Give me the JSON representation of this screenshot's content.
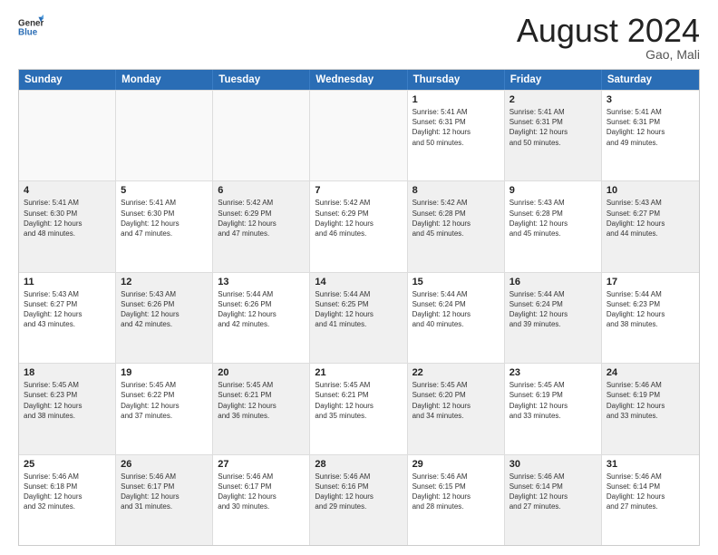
{
  "logo": {
    "general": "General",
    "blue": "Blue"
  },
  "title": {
    "month_year": "August 2024",
    "location": "Gao, Mali"
  },
  "weekdays": [
    "Sunday",
    "Monday",
    "Tuesday",
    "Wednesday",
    "Thursday",
    "Friday",
    "Saturday"
  ],
  "rows": [
    [
      {
        "day": "",
        "info": "",
        "empty": true
      },
      {
        "day": "",
        "info": "",
        "empty": true
      },
      {
        "day": "",
        "info": "",
        "empty": true
      },
      {
        "day": "",
        "info": "",
        "empty": true
      },
      {
        "day": "1",
        "info": "Sunrise: 5:41 AM\nSunset: 6:31 PM\nDaylight: 12 hours\nand 50 minutes.",
        "empty": false
      },
      {
        "day": "2",
        "info": "Sunrise: 5:41 AM\nSunset: 6:31 PM\nDaylight: 12 hours\nand 50 minutes.",
        "empty": false,
        "shaded": true
      },
      {
        "day": "3",
        "info": "Sunrise: 5:41 AM\nSunset: 6:31 PM\nDaylight: 12 hours\nand 49 minutes.",
        "empty": false
      }
    ],
    [
      {
        "day": "4",
        "info": "Sunrise: 5:41 AM\nSunset: 6:30 PM\nDaylight: 12 hours\nand 48 minutes.",
        "empty": false,
        "shaded": true
      },
      {
        "day": "5",
        "info": "Sunrise: 5:41 AM\nSunset: 6:30 PM\nDaylight: 12 hours\nand 47 minutes.",
        "empty": false
      },
      {
        "day": "6",
        "info": "Sunrise: 5:42 AM\nSunset: 6:29 PM\nDaylight: 12 hours\nand 47 minutes.",
        "empty": false,
        "shaded": true
      },
      {
        "day": "7",
        "info": "Sunrise: 5:42 AM\nSunset: 6:29 PM\nDaylight: 12 hours\nand 46 minutes.",
        "empty": false
      },
      {
        "day": "8",
        "info": "Sunrise: 5:42 AM\nSunset: 6:28 PM\nDaylight: 12 hours\nand 45 minutes.",
        "empty": false,
        "shaded": true
      },
      {
        "day": "9",
        "info": "Sunrise: 5:43 AM\nSunset: 6:28 PM\nDaylight: 12 hours\nand 45 minutes.",
        "empty": false
      },
      {
        "day": "10",
        "info": "Sunrise: 5:43 AM\nSunset: 6:27 PM\nDaylight: 12 hours\nand 44 minutes.",
        "empty": false,
        "shaded": true
      }
    ],
    [
      {
        "day": "11",
        "info": "Sunrise: 5:43 AM\nSunset: 6:27 PM\nDaylight: 12 hours\nand 43 minutes.",
        "empty": false
      },
      {
        "day": "12",
        "info": "Sunrise: 5:43 AM\nSunset: 6:26 PM\nDaylight: 12 hours\nand 42 minutes.",
        "empty": false,
        "shaded": true
      },
      {
        "day": "13",
        "info": "Sunrise: 5:44 AM\nSunset: 6:26 PM\nDaylight: 12 hours\nand 42 minutes.",
        "empty": false
      },
      {
        "day": "14",
        "info": "Sunrise: 5:44 AM\nSunset: 6:25 PM\nDaylight: 12 hours\nand 41 minutes.",
        "empty": false,
        "shaded": true
      },
      {
        "day": "15",
        "info": "Sunrise: 5:44 AM\nSunset: 6:24 PM\nDaylight: 12 hours\nand 40 minutes.",
        "empty": false
      },
      {
        "day": "16",
        "info": "Sunrise: 5:44 AM\nSunset: 6:24 PM\nDaylight: 12 hours\nand 39 minutes.",
        "empty": false,
        "shaded": true
      },
      {
        "day": "17",
        "info": "Sunrise: 5:44 AM\nSunset: 6:23 PM\nDaylight: 12 hours\nand 38 minutes.",
        "empty": false
      }
    ],
    [
      {
        "day": "18",
        "info": "Sunrise: 5:45 AM\nSunset: 6:23 PM\nDaylight: 12 hours\nand 38 minutes.",
        "empty": false,
        "shaded": true
      },
      {
        "day": "19",
        "info": "Sunrise: 5:45 AM\nSunset: 6:22 PM\nDaylight: 12 hours\nand 37 minutes.",
        "empty": false
      },
      {
        "day": "20",
        "info": "Sunrise: 5:45 AM\nSunset: 6:21 PM\nDaylight: 12 hours\nand 36 minutes.",
        "empty": false,
        "shaded": true
      },
      {
        "day": "21",
        "info": "Sunrise: 5:45 AM\nSunset: 6:21 PM\nDaylight: 12 hours\nand 35 minutes.",
        "empty": false
      },
      {
        "day": "22",
        "info": "Sunrise: 5:45 AM\nSunset: 6:20 PM\nDaylight: 12 hours\nand 34 minutes.",
        "empty": false,
        "shaded": true
      },
      {
        "day": "23",
        "info": "Sunrise: 5:45 AM\nSunset: 6:19 PM\nDaylight: 12 hours\nand 33 minutes.",
        "empty": false
      },
      {
        "day": "24",
        "info": "Sunrise: 5:46 AM\nSunset: 6:19 PM\nDaylight: 12 hours\nand 33 minutes.",
        "empty": false,
        "shaded": true
      }
    ],
    [
      {
        "day": "25",
        "info": "Sunrise: 5:46 AM\nSunset: 6:18 PM\nDaylight: 12 hours\nand 32 minutes.",
        "empty": false
      },
      {
        "day": "26",
        "info": "Sunrise: 5:46 AM\nSunset: 6:17 PM\nDaylight: 12 hours\nand 31 minutes.",
        "empty": false,
        "shaded": true
      },
      {
        "day": "27",
        "info": "Sunrise: 5:46 AM\nSunset: 6:17 PM\nDaylight: 12 hours\nand 30 minutes.",
        "empty": false
      },
      {
        "day": "28",
        "info": "Sunrise: 5:46 AM\nSunset: 6:16 PM\nDaylight: 12 hours\nand 29 minutes.",
        "empty": false,
        "shaded": true
      },
      {
        "day": "29",
        "info": "Sunrise: 5:46 AM\nSunset: 6:15 PM\nDaylight: 12 hours\nand 28 minutes.",
        "empty": false
      },
      {
        "day": "30",
        "info": "Sunrise: 5:46 AM\nSunset: 6:14 PM\nDaylight: 12 hours\nand 27 minutes.",
        "empty": false,
        "shaded": true
      },
      {
        "day": "31",
        "info": "Sunrise: 5:46 AM\nSunset: 6:14 PM\nDaylight: 12 hours\nand 27 minutes.",
        "empty": false
      }
    ]
  ]
}
